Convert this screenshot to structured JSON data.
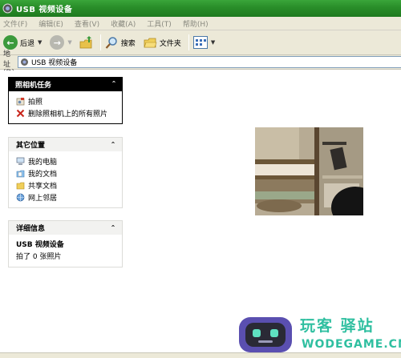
{
  "window": {
    "title": "USB 视频设备"
  },
  "menu": [
    "文件(F)",
    "编辑(E)",
    "查看(V)",
    "收藏(A)",
    "工具(T)",
    "帮助(H)"
  ],
  "toolbar": {
    "back_label": "后退",
    "search_label": "搜索",
    "folders_label": "文件夹"
  },
  "address": {
    "label": "地址(D)",
    "value": "USB 视频设备"
  },
  "camera_tasks": {
    "title": "照相机任务",
    "items": [
      {
        "label": "拍照",
        "icon": "camera-icon"
      },
      {
        "label": "删除照相机上的所有照片",
        "icon": "delete-x-icon"
      }
    ]
  },
  "other_places": {
    "title": "其它位置",
    "items": [
      {
        "label": "我的电脑",
        "icon": "my-computer-icon"
      },
      {
        "label": "我的文档",
        "icon": "my-documents-icon"
      },
      {
        "label": "共享文档",
        "icon": "shared-folder-icon"
      },
      {
        "label": "网上邻居",
        "icon": "network-icon"
      }
    ]
  },
  "details": {
    "title": "详细信息",
    "name": "USB 视频设备",
    "info": "拍了 0 张照片"
  },
  "watermark": {
    "brand": "玩客  驿站",
    "url": "WODEGAME.CN"
  },
  "colors": {
    "titlebar": "#2a8f2a",
    "taskbar": "#ece9d8",
    "panel_dark": "#000000"
  }
}
